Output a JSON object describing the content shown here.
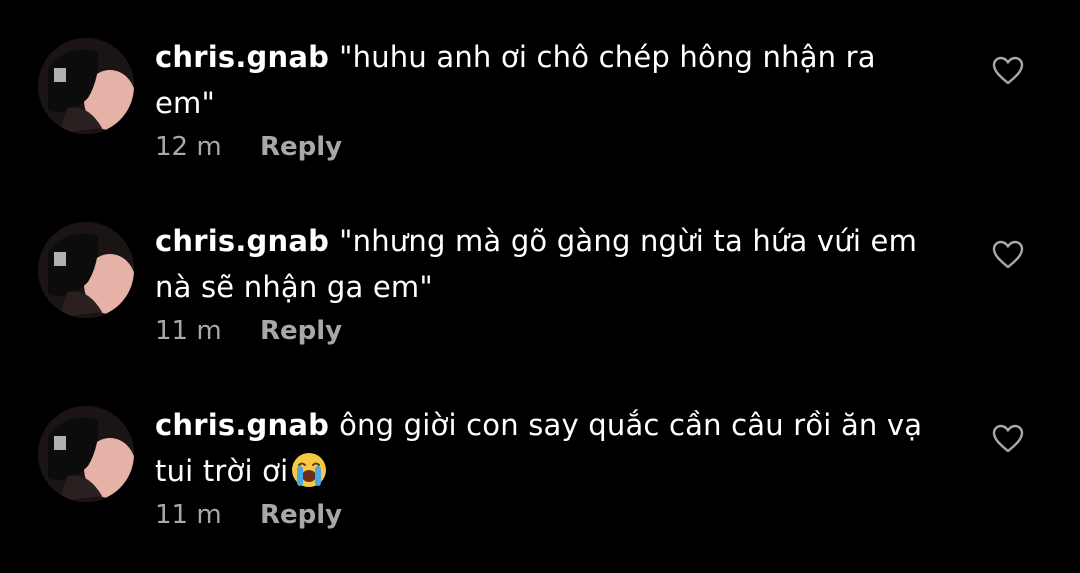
{
  "colors": {
    "background": "#000000",
    "text": "#ffffff",
    "secondary": "#a8a8a8"
  },
  "comments": [
    {
      "username": "chris.gnab",
      "text": "\"huhu anh ơi chô chép hông nhận ra em\"",
      "time": "12 m",
      "reply_label": "Reply",
      "like_icon": "heart-outline-icon"
    },
    {
      "username": "chris.gnab",
      "text": "\"nhưng mà gõ gàng ngừi ta hứa vứi em nà sẽ nhận ga em\"",
      "time": "11 m",
      "reply_label": "Reply",
      "like_icon": "heart-outline-icon"
    },
    {
      "username": "chris.gnab",
      "text": "ông giời con say quắc cần câu rồi ăn vạ tui trời ơi",
      "emoji": "loudly-crying-face-emoji",
      "time": "11 m",
      "reply_label": "Reply",
      "like_icon": "heart-outline-icon"
    }
  ]
}
